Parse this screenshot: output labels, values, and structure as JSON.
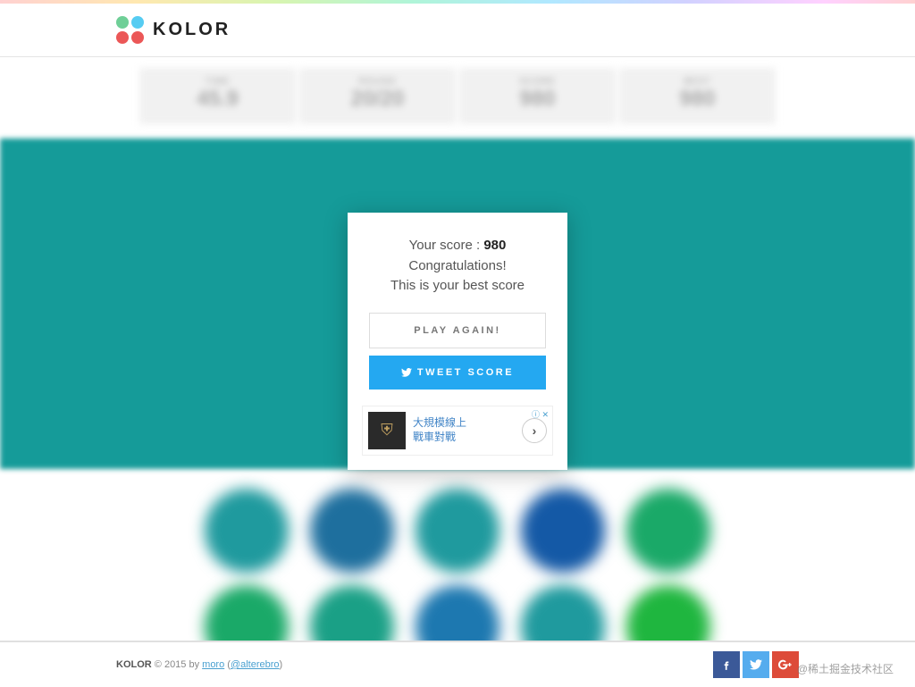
{
  "brand": "KOLOR",
  "stats": {
    "time_label": "TIME",
    "time_value": "45.9",
    "round_label": "ROUND",
    "round_value": "20/20",
    "score_label": "SCORE",
    "score_value": "980",
    "best_label": "BEST",
    "best_value": "980"
  },
  "modal": {
    "score_prefix": "Your score : ",
    "score_value": "980",
    "congrats": "Congratulations!",
    "best_msg": "This is your best score",
    "play_label": "PLAY AGAIN!",
    "tweet_label": "TWEET SCORE"
  },
  "ad": {
    "line1": "大規模線上",
    "line2": "戰車對戰",
    "badge": "ⓘ ✕"
  },
  "game": {
    "panel_color": "#159b99",
    "circle_colors_row1": [
      "#1f9a9e",
      "#1e6f9e",
      "#1f9a9e",
      "#1459a6",
      "#1aa968"
    ],
    "circle_colors_row2": [
      "#1aa968",
      "#1aa086",
      "#1d78b0",
      "#1f9a9e",
      "#1fb63f"
    ]
  },
  "footer": {
    "text_prefix": "KOLOR",
    "copyright": " © 2015 by ",
    "author": "moro",
    "handle_open": " (",
    "handle": "@alterebro",
    "handle_close": ")"
  },
  "watermark": "@稀土掘金技术社区"
}
